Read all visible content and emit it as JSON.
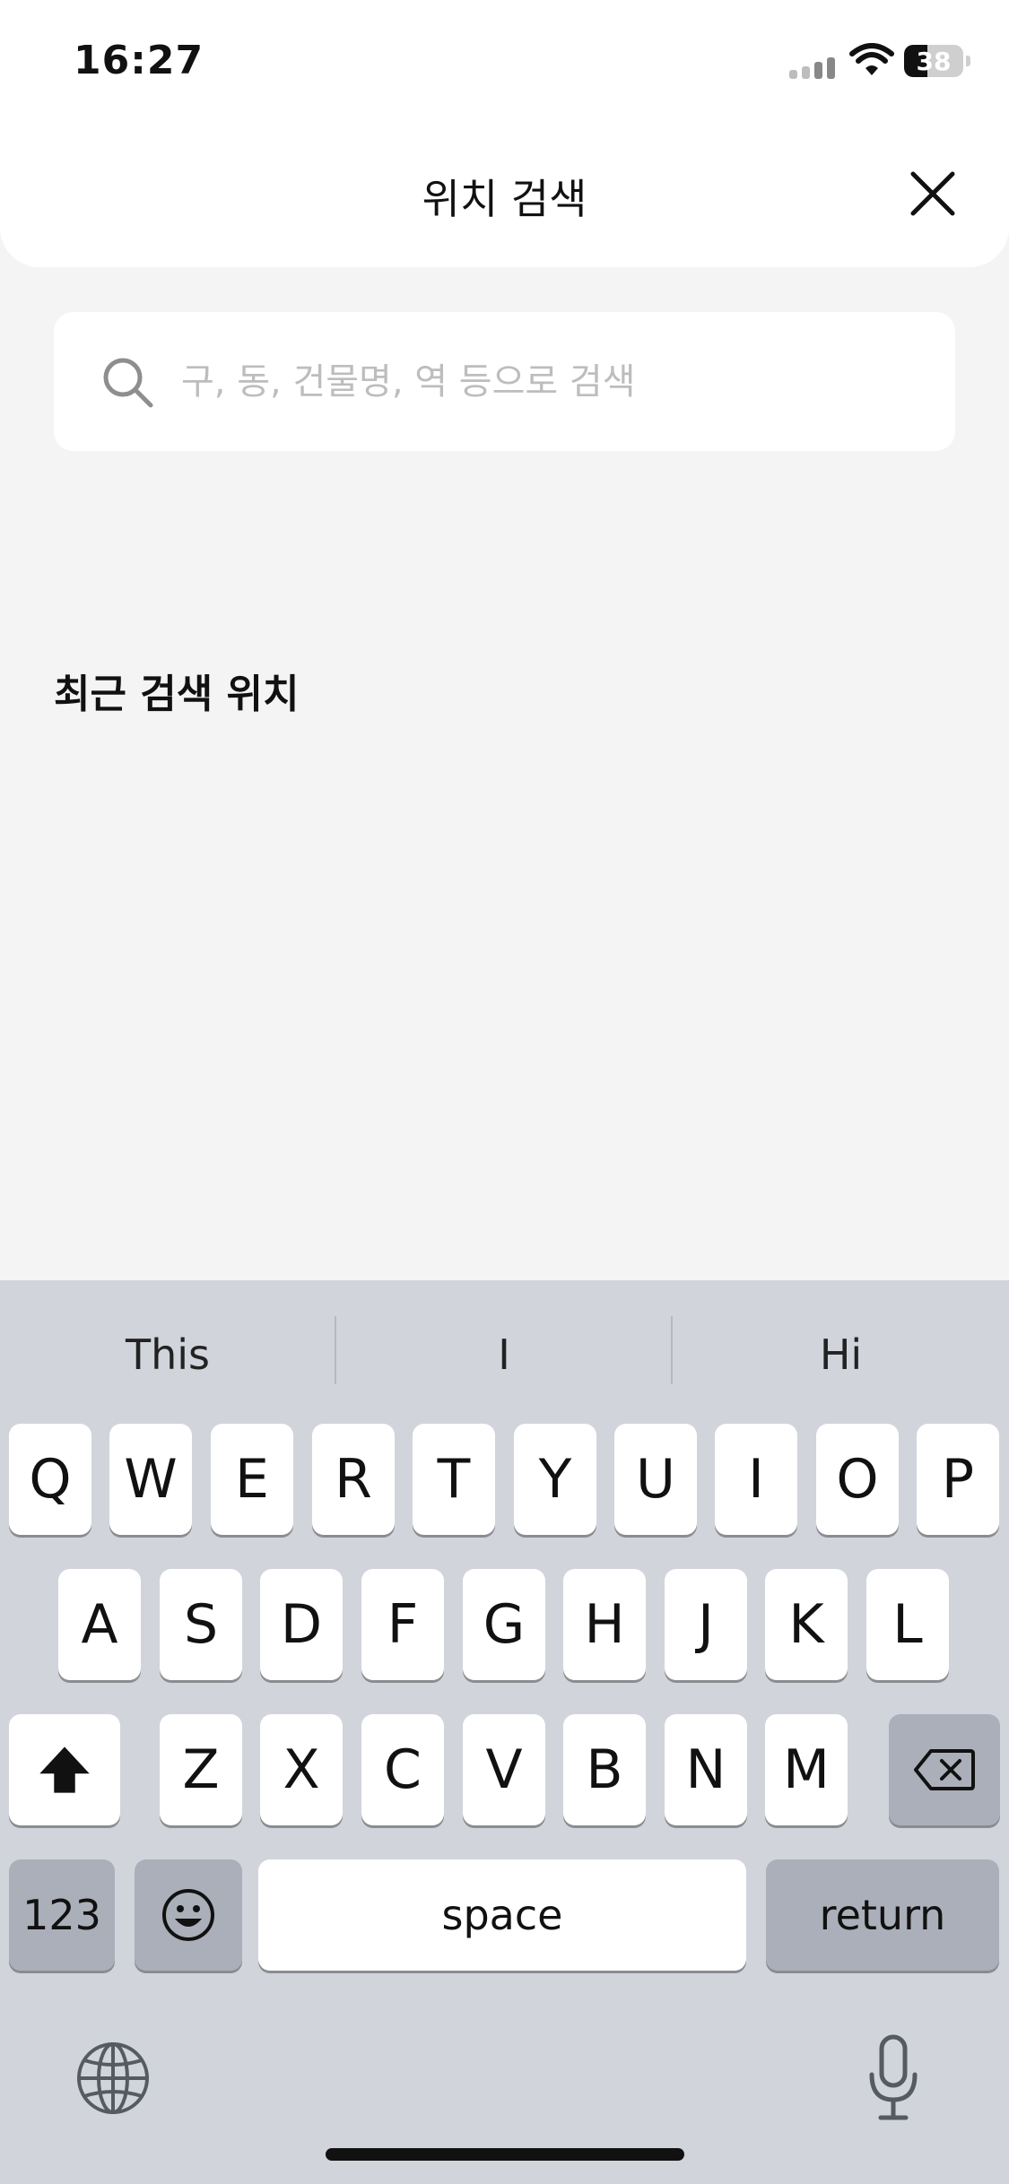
{
  "status_bar": {
    "time": "16:27",
    "battery": "38"
  },
  "header": {
    "title": "위치 검색"
  },
  "search": {
    "placeholder": "구, 동, 건물명, 역 등으로 검색",
    "value": ""
  },
  "recent": {
    "title": "최근 검색 위치"
  },
  "keyboard": {
    "suggestions": [
      "This",
      "I",
      "Hi"
    ],
    "row1": [
      "Q",
      "W",
      "E",
      "R",
      "T",
      "Y",
      "U",
      "I",
      "O",
      "P"
    ],
    "row2": [
      "A",
      "S",
      "D",
      "F",
      "G",
      "H",
      "J",
      "K",
      "L"
    ],
    "row3": [
      "Z",
      "X",
      "C",
      "V",
      "B",
      "N",
      "M"
    ],
    "numbers_label": "123",
    "space_label": "space",
    "return_label": "return"
  }
}
